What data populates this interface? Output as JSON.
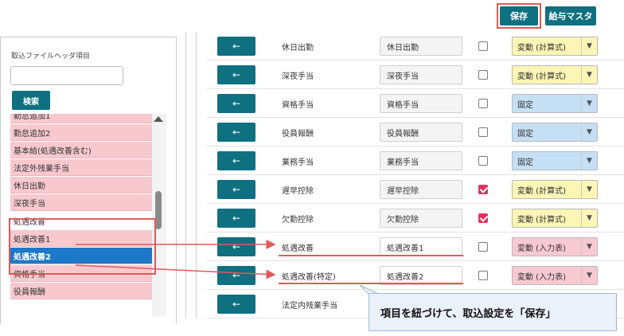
{
  "toolbar": {
    "save_label": "保存",
    "salary_master_label": "給与マスタ"
  },
  "left": {
    "header_label": "取込ファイルヘッダ項目",
    "search_value": "",
    "search_button": "検索",
    "list_items": [
      {
        "label": "勤怠追加1",
        "style": "pink"
      },
      {
        "label": "勤怠追加2",
        "style": "pink"
      },
      {
        "label": "基本給(処遇改善含む)",
        "style": "pink"
      },
      {
        "label": "法定外残業手当",
        "style": "pink"
      },
      {
        "label": "休日出勤",
        "style": "pink"
      },
      {
        "label": "深夜手当",
        "style": "pink"
      },
      {
        "label": "処遇改善",
        "style": "white"
      },
      {
        "label": "処遇改善1",
        "style": "pink"
      },
      {
        "label": "処遇改善2",
        "style": "selected"
      },
      {
        "label": "資格手当",
        "style": "pink"
      },
      {
        "label": "役員報酬",
        "style": "pink"
      }
    ]
  },
  "rows": [
    {
      "arrow": "←",
      "label": "休日出勤",
      "field": "休日出勤",
      "checked": false,
      "select": "変動 (計算式)",
      "color": "yellow"
    },
    {
      "arrow": "←",
      "label": "深夜手当",
      "field": "深夜手当",
      "checked": false,
      "select": "変動 (計算式)",
      "color": "yellow"
    },
    {
      "arrow": "←",
      "label": "資格手当",
      "field": "資格手当",
      "checked": false,
      "select": "固定",
      "color": "blue"
    },
    {
      "arrow": "←",
      "label": "役員報酬",
      "field": "役員報酬",
      "checked": false,
      "select": "固定",
      "color": "blue"
    },
    {
      "arrow": "←",
      "label": "業務手当",
      "field": "業務手当",
      "checked": false,
      "select": "固定",
      "color": "blue"
    },
    {
      "arrow": "←",
      "label": "遅早控除",
      "field": "遅早控除",
      "checked": true,
      "select": "変動 (計算式)",
      "color": "yellow"
    },
    {
      "arrow": "←",
      "label": "欠勤控除",
      "field": "欠勤控除",
      "checked": true,
      "select": "変動 (計算式)",
      "color": "yellow"
    },
    {
      "arrow": "←",
      "label": "処遇改善",
      "field": "処遇改善1",
      "checked": false,
      "select": "変動 (入力表)",
      "color": "pink"
    },
    {
      "arrow": "←",
      "label": "処遇改善(特定)",
      "field": "処遇改善2",
      "checked": false,
      "select": "変動 (入力表)",
      "color": "pink"
    },
    {
      "arrow": "←",
      "label": "法定内残業手当",
      "field": "",
      "checked": false,
      "select": "",
      "color": "none"
    }
  ],
  "select_arrow": "▼",
  "callout": {
    "text": "項目を紐づけて、取込設定を「保存」"
  },
  "colors": {
    "teal": "#0e7080",
    "highlight_red": "#e05a5a",
    "selected_blue": "#1e78c8",
    "list_pink": "#f7c9ce"
  }
}
